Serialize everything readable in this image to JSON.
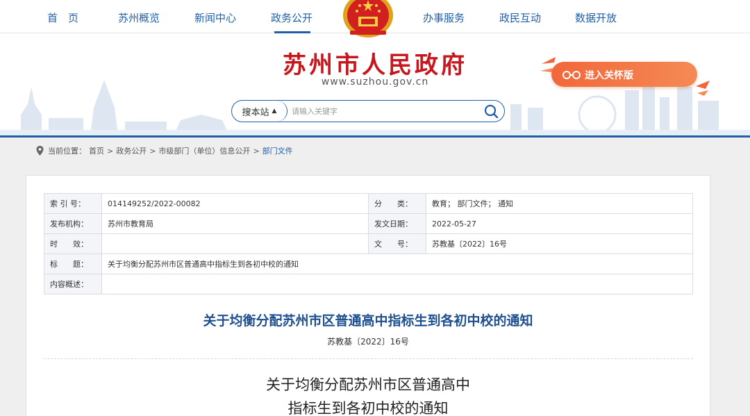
{
  "nav": {
    "items": [
      "首　页",
      "苏州概览",
      "新闻中心",
      "政务公开",
      "办事服务",
      "政民互动",
      "数据开放"
    ],
    "active": "政务公开"
  },
  "header": {
    "title": "苏州市人民政府",
    "url": "www.suzhou.gov.cn",
    "care_label": "进入关怀版"
  },
  "search": {
    "scope": "搜本站",
    "placeholder": "请输入关键字"
  },
  "breadcrumb": {
    "prefix": "当前位置：",
    "items": [
      "首页",
      "政务公开",
      "市级部门（单位）信息公开",
      "部门文件"
    ]
  },
  "meta": {
    "index_label": "索 引 号：",
    "index_value": "014149252/2022-00082",
    "category_label": "分　　类：",
    "category_value": "教育；  部门文件；  通知",
    "issuer_label": "发布机构：",
    "issuer_value": "苏州市教育局",
    "date_label": "发文日期：",
    "date_value": "2022-05-27",
    "validity_label": "时　　效：",
    "validity_value": "",
    "docno_label": "文　　号：",
    "docno_value": "苏教基〔2022〕16号",
    "title_label": "标　　题：",
    "title_value": "关于均衡分配苏州市区普通高中指标生到各初中校的通知",
    "summary_label": "内容概述：",
    "summary_value": ""
  },
  "document": {
    "title": "关于均衡分配苏州市区普通高中指标生到各初中校的通知",
    "number": "苏教基〔2022〕16号",
    "body_title_line1": "关于均衡分配苏州市区普通高中",
    "body_title_line2": "指标生到各初中校的通知"
  },
  "colors": {
    "brand_blue": "#1f5fa8",
    "title_red": "#c8161d",
    "care_orange": "#f1673a"
  }
}
